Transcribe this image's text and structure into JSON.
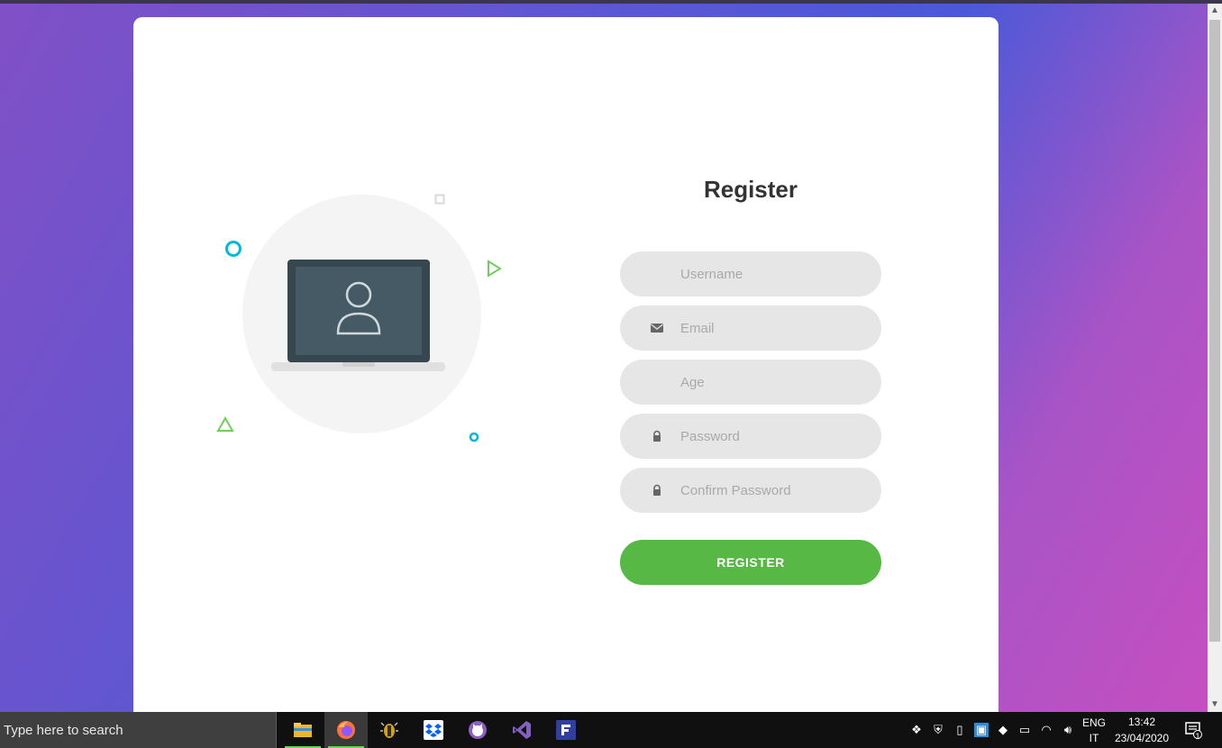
{
  "form": {
    "title": "Register",
    "username_placeholder": "Username",
    "email_placeholder": "Email",
    "age_placeholder": "Age",
    "password_placeholder": "Password",
    "confirm_placeholder": "Confirm Password",
    "submit_label": "REGISTER"
  },
  "taskbar": {
    "search_placeholder": "Type here to search",
    "apps": [
      "file-explorer",
      "firefox",
      "bug-tracker",
      "dropbox",
      "github-desktop",
      "visual-studio",
      "flow"
    ],
    "language_top": "ENG",
    "language_bottom": "IT",
    "time": "13:42",
    "date": "23/04/2020",
    "notification_count": "1"
  },
  "colors": {
    "accent_green": "#57b846",
    "input_bg": "#e6e6e6",
    "deco_cyan": "#00b8d9",
    "deco_green": "#6fcf5a"
  }
}
